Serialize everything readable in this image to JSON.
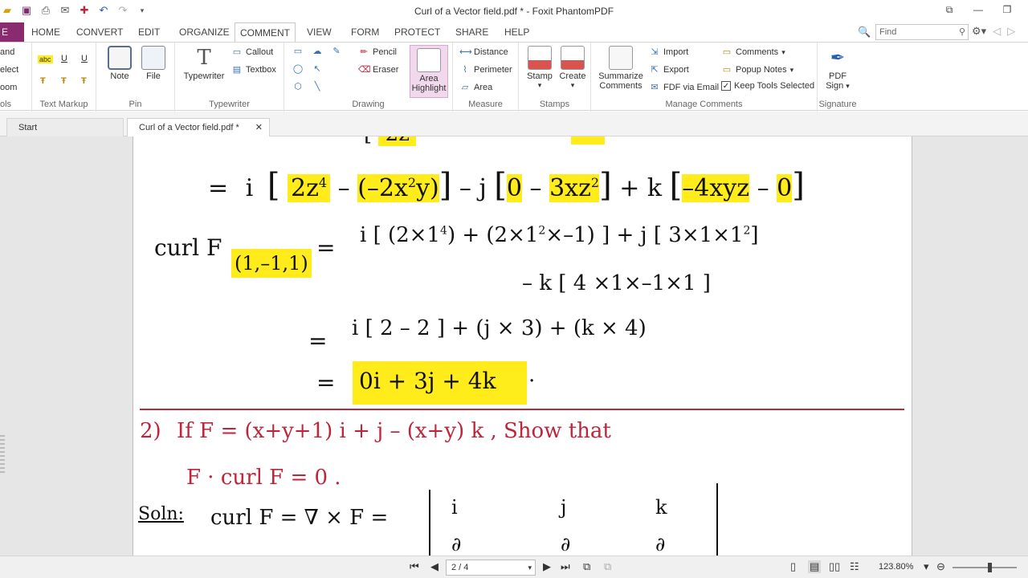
{
  "window": {
    "title": "Curl of a Vector field.pdf * - Foxit PhantomPDF",
    "controls": [
      "restore-down",
      "minimize",
      "maximize"
    ]
  },
  "menu": {
    "file_tab": "E",
    "items": [
      "HOME",
      "CONVERT",
      "EDIT",
      "ORGANIZE",
      "COMMENT",
      "VIEW",
      "FORM",
      "PROTECT",
      "SHARE",
      "HELP"
    ],
    "active": "COMMENT",
    "find_placeholder": "Find"
  },
  "ribbon": {
    "tools_partial": {
      "lines": [
        "and",
        "elect",
        "oom"
      ],
      "label": "ols"
    },
    "text_markup": {
      "label": "Text Markup"
    },
    "pin": {
      "note": "Note",
      "file": "File",
      "label": "Pin"
    },
    "typewriter": {
      "typewriter": "Typewriter",
      "callout": "Callout",
      "textbox": "Textbox",
      "label": "Typewriter"
    },
    "drawing": {
      "pencil": "Pencil",
      "eraser": "Eraser",
      "area_highlight_1": "Area",
      "area_highlight_2": "Highlight",
      "label": "Drawing"
    },
    "measure": {
      "distance": "Distance",
      "perimeter": "Perimeter",
      "area": "Area",
      "label": "Measure"
    },
    "stamps": {
      "stamp": "Stamp",
      "create": "Create",
      "label": "Stamps"
    },
    "manage": {
      "summarize_1": "Summarize",
      "summarize_2": "Comments",
      "import": "Import",
      "export": "Export",
      "fdf_email": "FDF via Email",
      "comments": "Comments",
      "popup_notes": "Popup Notes",
      "keep_tools": "Keep Tools Selected",
      "label": "Manage Comments"
    },
    "signature": {
      "pdf_1": "PDF",
      "pdf_2": "Sign",
      "label": "Signature"
    }
  },
  "tabs": [
    {
      "label": "Start"
    },
    {
      "label": "Curl of a Vector field.pdf *"
    }
  ],
  "document": {
    "line1": {
      "eq": "=",
      "i": "i",
      "a": "2z",
      "a_sup": "4",
      "minus": "–",
      "b": "(–2x",
      "b_sup": "2",
      "b_end": "y)",
      "j": "– j",
      "c": "0",
      "minus2": "–",
      "d": "3xz",
      "d_sup": "2",
      "k": "+ k",
      "e": "–4xyz",
      "minus3": "–",
      "f": "0"
    },
    "line2": {
      "curl": "curl F",
      "sub": "(1,–1,1)",
      "eq": "=",
      "rest": "i [ (2×1",
      "rest_sup": "4",
      "rest2": ") + (2×1",
      "rest2_sup": "2",
      "rest3": "×–1) ] + j [ 3×1×1",
      "rest3_sup": "2",
      "rest4": "]"
    },
    "line3": "– k [ 4 ×1×–1×1 ]",
    "line4": {
      "eq": "=",
      "text": "i [ 2 – 2 ] + (j × 3) + (k × 4)"
    },
    "line5": {
      "eq": "=",
      "result": "0i + 3j + 4k",
      "dot": "."
    },
    "problem": {
      "num": "2)",
      "text": "If  F = (x+y+1) i + j – (x+y) k ,  Show  that"
    },
    "problem2": "F · curl F = 0 .",
    "solution": {
      "label": "Soln:",
      "text": "curl F = ∇ × F ="
    },
    "matrix_row1": [
      "i",
      "j",
      "k"
    ],
    "matrix_row2": [
      "∂",
      "∂",
      "∂"
    ]
  },
  "statusbar": {
    "page": "2 / 4",
    "zoom": "123.80%"
  }
}
